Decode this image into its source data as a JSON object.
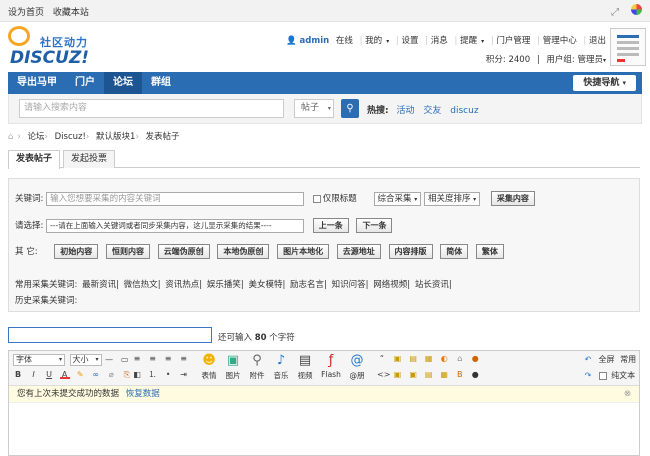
{
  "topbar": {
    "home": "设为首页",
    "fav": "收藏本站"
  },
  "logo": {
    "cn": "社区动力",
    "en": "DISCUZ!"
  },
  "user": {
    "name": "admin",
    "status": "在线",
    "links": [
      "我的",
      "设置",
      "消息",
      "提醒",
      "门户管理",
      "管理中心",
      "退出"
    ],
    "points": "积分: 2400",
    "group": "用户组: 管理员"
  },
  "nav": {
    "items": [
      "导出马甲",
      "门户",
      "论坛",
      "群组"
    ],
    "quick": "快捷导航"
  },
  "search": {
    "placeholder": "请输入搜索内容",
    "type": "帖子",
    "hot_label": "热搜:",
    "hot": [
      "活动",
      "交友",
      "discuz"
    ]
  },
  "breadcrumb": [
    "论坛",
    "Discuz!",
    "默认版块1",
    "发表帖子"
  ],
  "tabs": [
    "发表帖子",
    "发起投票"
  ],
  "collect": {
    "kw_label": "关键词:",
    "kw_placeholder": "输入您想要采集的内容关键词",
    "title_only": "仅限标题",
    "mode": "综合采集",
    "sort": "相关度排序",
    "collect_btn": "采集内容",
    "select_label": "请选择:",
    "select_value": "---请在上面输入关键词或者同步采集内容，这儿显示采集的结果----",
    "prev": "上一条",
    "next": "下一条",
    "other_label": "其 它:",
    "tools": [
      "初始内容",
      "恒则内容",
      "云端伪原创",
      "本地伪原创",
      "图片本地化",
      "去源地址",
      "内容排版",
      "简体",
      "繁体"
    ],
    "common_label": "常用采集关键词:",
    "common": [
      "最新资讯",
      "微信热文",
      "资讯热点",
      "娱乐播笑",
      "美女模特",
      "励志名言",
      "知识问答",
      "网络视频",
      "站长资讯"
    ],
    "history_label": "历史采集关键词:"
  },
  "title_hint": {
    "pre": "还可输入",
    "num": "80",
    "post": "个字符"
  },
  "editor": {
    "font": "字体",
    "size": "大小",
    "big": [
      "表情",
      "图片",
      "附件",
      "音乐",
      "视频",
      "Flash",
      "@朋"
    ],
    "fullscreen": "全屏",
    "common": "常用",
    "plain": "纯文本",
    "notice": "您有上次未提交成功的数据",
    "restore": "恢复数据"
  },
  "colors": {
    "primary": "#2b6db3",
    "nav_active": "#1d5593"
  }
}
